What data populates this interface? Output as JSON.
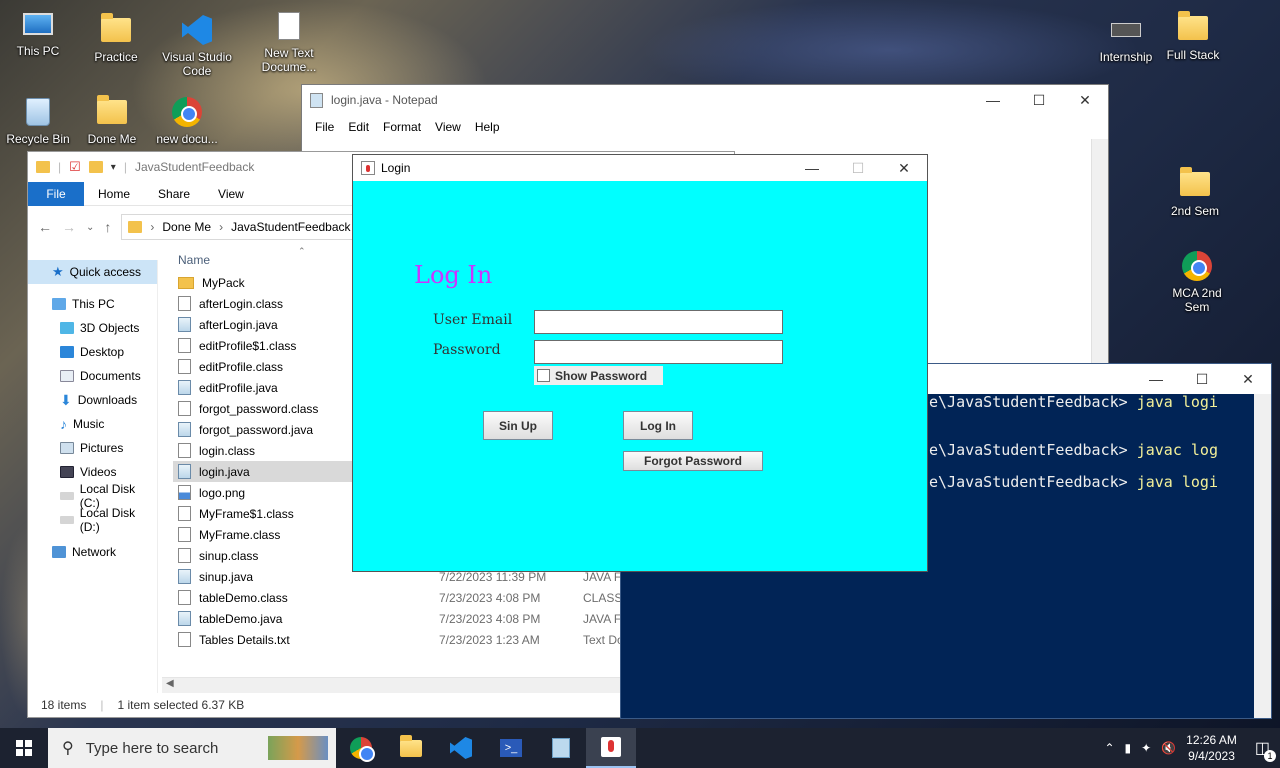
{
  "desktop": {
    "icons": [
      {
        "label": "This PC",
        "icon": "this-pc-icon"
      },
      {
        "label": "Practice",
        "icon": "folder-icon"
      },
      {
        "label": "Visual Studio Code",
        "icon": "vscode-icon"
      },
      {
        "label": "New Text Docume...",
        "icon": "text-document-icon"
      },
      {
        "label": "Recycle Bin",
        "icon": "recycle-bin-icon"
      },
      {
        "label": "Done Me",
        "icon": "folder-icon"
      },
      {
        "label": "new docu...",
        "icon": "chrome-icon"
      },
      {
        "label": "Internship",
        "icon": "chip-icon"
      },
      {
        "label": "Full Stack",
        "icon": "folder-icon"
      },
      {
        "label": "2nd Sem",
        "icon": "folder-icon"
      },
      {
        "label": "MCA 2nd Sem",
        "icon": "chrome-icon"
      }
    ]
  },
  "notepad": {
    "title": "login.java - Notepad",
    "menu": [
      "File",
      "Edit",
      "Format",
      "View",
      "Help"
    ]
  },
  "explorer": {
    "title": "JavaStudentFeedback",
    "ribbon": {
      "file": "File",
      "tabs": [
        "Home",
        "Share",
        "View"
      ]
    },
    "breadcrumb": [
      "Done Me",
      "JavaStudentFeedback"
    ],
    "nav": [
      {
        "label": "Quick access",
        "level": "top",
        "selected": true
      },
      {
        "label": "This PC",
        "level": "top"
      },
      {
        "label": "3D Objects"
      },
      {
        "label": "Desktop"
      },
      {
        "label": "Documents"
      },
      {
        "label": "Downloads"
      },
      {
        "label": "Music"
      },
      {
        "label": "Pictures"
      },
      {
        "label": "Videos"
      },
      {
        "label": "Local Disk (C:)"
      },
      {
        "label": "Local Disk (D:)"
      },
      {
        "label": "Network",
        "level": "top"
      }
    ],
    "column_name": "Name",
    "files": [
      {
        "name": "MyPack",
        "kind": "folder",
        "date": "",
        "type": ""
      },
      {
        "name": "afterLogin.class",
        "kind": "class",
        "date": "",
        "type": ""
      },
      {
        "name": "afterLogin.java",
        "kind": "java",
        "date": "",
        "type": ""
      },
      {
        "name": "editProfile$1.class",
        "kind": "class",
        "date": "",
        "type": ""
      },
      {
        "name": "editProfile.class",
        "kind": "class",
        "date": "",
        "type": ""
      },
      {
        "name": "editProfile.java",
        "kind": "java",
        "date": "",
        "type": ""
      },
      {
        "name": "forgot_password.class",
        "kind": "class",
        "date": "",
        "type": ""
      },
      {
        "name": "forgot_password.java",
        "kind": "java",
        "date": "",
        "type": ""
      },
      {
        "name": "login.class",
        "kind": "class",
        "date": "",
        "type": ""
      },
      {
        "name": "login.java",
        "kind": "java",
        "date": "",
        "type": "",
        "selected": true
      },
      {
        "name": "logo.png",
        "kind": "png",
        "date": "",
        "type": ""
      },
      {
        "name": "MyFrame$1.class",
        "kind": "class",
        "date": "",
        "type": ""
      },
      {
        "name": "MyFrame.class",
        "kind": "class",
        "date": "",
        "type": ""
      },
      {
        "name": "sinup.class",
        "kind": "class",
        "date": "",
        "type": ""
      },
      {
        "name": "sinup.java",
        "kind": "java",
        "date": "7/22/2023 11:39 PM",
        "type": "JAVA Fi"
      },
      {
        "name": "tableDemo.class",
        "kind": "class",
        "date": "7/23/2023 4:08 PM",
        "type": "CLASS F"
      },
      {
        "name": "tableDemo.java",
        "kind": "java",
        "date": "7/23/2023 4:08 PM",
        "type": "JAVA Fi"
      },
      {
        "name": "Tables Details.txt",
        "kind": "txt",
        "date": "7/23/2023 1:23 AM",
        "type": "Text Do"
      }
    ],
    "status": {
      "count": "18 items",
      "selection": "1 item selected  6.37 KB"
    }
  },
  "powershell": {
    "lines": [
      {
        "prompt": "e\\JavaStudentFeedback> ",
        "cmd": "java logi"
      },
      {
        "prompt": "e\\JavaStudentFeedback> ",
        "cmd": "javac log"
      },
      {
        "prompt": "e\\JavaStudentFeedback> ",
        "cmd": "java logi"
      }
    ]
  },
  "login": {
    "title": "Login",
    "heading": "Log In",
    "email_label": "User Email",
    "password_label": "Password",
    "email_value": "",
    "password_value": "",
    "show_password": "Show Password",
    "signup_button": "Sin Up",
    "login_button": "Log In",
    "forgot_button": "Forgot Password",
    "background": "#00ffff",
    "heading_color": "#cc33ff"
  },
  "taskbar": {
    "search_placeholder": "Type here to search",
    "time": "12:26 AM",
    "date": "9/4/2023",
    "apps": [
      "chrome-icon",
      "file-explorer-icon",
      "vscode-icon",
      "powershell-icon",
      "notepad-icon",
      "java-icon"
    ],
    "notification_count": "1"
  }
}
